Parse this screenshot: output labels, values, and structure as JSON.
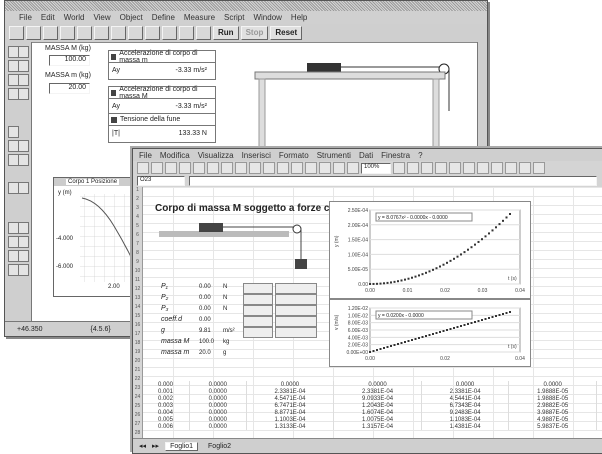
{
  "back_window": {
    "menu": [
      "File",
      "Edit",
      "World",
      "View",
      "Object",
      "Define",
      "Measure",
      "Script",
      "Window",
      "Help"
    ],
    "toolbar_buttons": [
      "Run",
      "Stop",
      "Reset"
    ],
    "mass_label": "MASSA M (kg)",
    "mass_value": "100.00",
    "mass2_label": "MASSA m (kg)",
    "mass2_value": "20.00",
    "meters": [
      {
        "title": "Accelerazione di corpo di massa m",
        "label": "Ay",
        "value": "-3.33 m/s²"
      },
      {
        "title": "Accelerazione di corpo di massa M",
        "label": "Ay",
        "value": "-3.33 m/s²"
      },
      {
        "title": "Tensione della fune",
        "label": "|T|",
        "value": "133.33 N"
      }
    ],
    "graph_title": "Corpo 1 Posizione",
    "graph_axis": "y (m)",
    "graph_yticks": [
      "-4.000",
      "-6.000"
    ],
    "graph_xtick": "2.00",
    "status_left": "+46.350",
    "status_mid": "{4.5.6}"
  },
  "excel": {
    "menu": [
      "File",
      "Modifica",
      "Visualizza",
      "Inserisci",
      "Formato",
      "Strumenti",
      "Dati",
      "Finestra",
      "?"
    ],
    "zoom": "100%",
    "cell_ref": "O23",
    "sheet_title": "Corpo di massa M soggetto a forze costanti",
    "params": [
      {
        "name": "P₁",
        "value": "0.00",
        "unit": "N"
      },
      {
        "name": "P₂",
        "value": "0.00",
        "unit": "N"
      },
      {
        "name": "P₃",
        "value": "0.00",
        "unit": "N"
      },
      {
        "name": "coeff.d",
        "value": "0.00",
        "unit": ""
      },
      {
        "name": "g",
        "value": "9.81",
        "unit": "m/s²"
      },
      {
        "name": "massa M",
        "value": "100.0",
        "unit": "kg"
      },
      {
        "name": "massa m",
        "value": "20.0",
        "unit": "g"
      }
    ],
    "chart1": {
      "equation": "y = 8.0767x² - 0.0000x - 0.0000",
      "ylabel": "y (m)",
      "xlabel": "t (s)",
      "yticks": [
        "2.50E-04",
        "2.00E-04",
        "1.50E-04",
        "1.00E-04",
        "5.00E-05",
        "0.00"
      ],
      "xticks": [
        "0.00",
        "0.01",
        "0.02",
        "0.03",
        "0.04"
      ]
    },
    "chart2": {
      "equation": "y = 0.0200x - 0.0000",
      "ylabel": "v (m/s)",
      "xlabel": "t (s)",
      "yticks": [
        "1.20E-02",
        "1.00E-02",
        "8.00E-03",
        "6.00E-03",
        "4.00E-03",
        "2.00E-03",
        "0.00E+00"
      ],
      "xticks": [
        "0.00",
        "0.02",
        "0.04"
      ]
    },
    "table_rows": [
      [
        "0.000",
        "0.0000",
        "0.0000",
        "0.0000",
        "0.0000",
        "0.0000"
      ],
      [
        "0.001",
        "0.0000",
        "2.3381E-04",
        "2.3381E-04",
        "2.3381E-04",
        "1.9888E-05"
      ],
      [
        "0.002",
        "0.0000",
        "4.5471E-04",
        "9.0933E-04",
        "4.5441E-04",
        "1.9888E-05"
      ],
      [
        "0.003",
        "0.0000",
        "6.7471E-04",
        "1.2043E-04",
        "6.7343E-04",
        "2.9882E-05"
      ],
      [
        "0.004",
        "0.0000",
        "8.8771E-04",
        "1.6074E-04",
        "9.2483E-04",
        "3.9887E-05"
      ],
      [
        "0.005",
        "0.0000",
        "1.1003E-04",
        "1.0075E-04",
        "1.1083E-04",
        "4.9887E-05"
      ],
      [
        "0.006",
        "0.0000",
        "1.3133E-04",
        "1.3157E-04",
        "1.4381E-04",
        "5.9837E-05"
      ]
    ],
    "sheet_tabs": [
      "Foglio1",
      "Foglio2"
    ]
  }
}
